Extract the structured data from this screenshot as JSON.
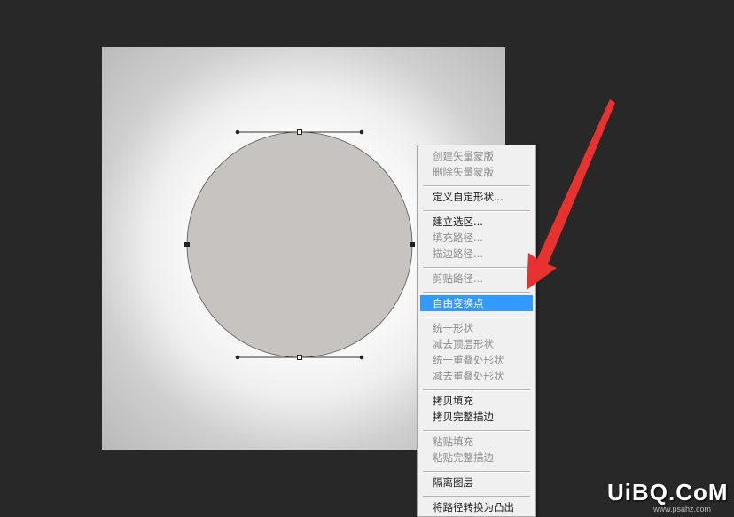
{
  "context_menu": {
    "items": [
      {
        "label": "创建矢量蒙版",
        "enabled": false
      },
      {
        "label": "删除矢量蒙版",
        "enabled": false
      },
      {
        "label": "定义自定形状...",
        "enabled": true
      },
      {
        "label": "建立选区...",
        "enabled": true
      },
      {
        "label": "填充路径...",
        "enabled": false
      },
      {
        "label": "描边路径...",
        "enabled": false
      },
      {
        "label": "剪贴路径...",
        "enabled": false
      },
      {
        "label": "自由变换点",
        "enabled": true,
        "highlighted": true
      },
      {
        "label": "统一形状",
        "enabled": false
      },
      {
        "label": "减去顶层形状",
        "enabled": false
      },
      {
        "label": "统一重叠处形状",
        "enabled": false
      },
      {
        "label": "减去重叠处形状",
        "enabled": false
      },
      {
        "label": "拷贝填充",
        "enabled": true
      },
      {
        "label": "拷贝完整描边",
        "enabled": true
      },
      {
        "label": "粘贴填充",
        "enabled": false
      },
      {
        "label": "粘贴完整描边",
        "enabled": false
      },
      {
        "label": "隔离图层",
        "enabled": true
      },
      {
        "label": "将路径转换为凸出",
        "enabled": true
      }
    ]
  },
  "colors": {
    "workspace_bg": "#282828",
    "shape_fill": "#c6c3c1",
    "highlight": "#3399ff",
    "arrow": "#e8322f"
  },
  "watermark": {
    "main": "UiBQ.CoM",
    "sub": "www.psahz.com"
  }
}
